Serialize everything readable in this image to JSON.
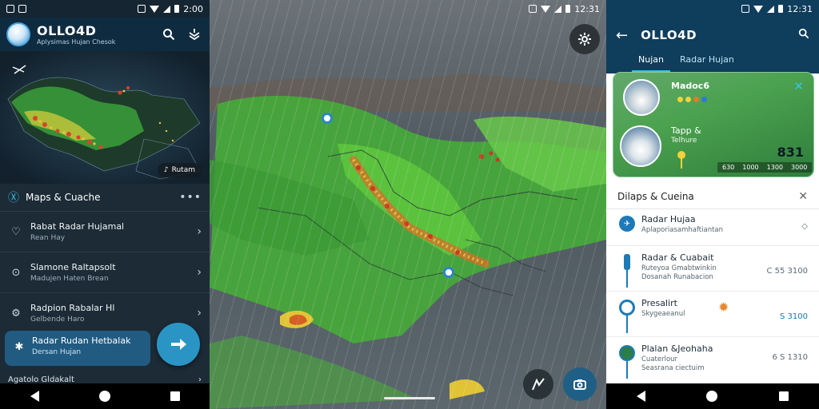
{
  "status": {
    "left_time": "2:00",
    "middle_time": "12:31",
    "right_time": "12:31"
  },
  "left_screen": {
    "app_title": "OLLO4D",
    "app_subtitle": "Aplysimas Hujan Chesok",
    "map_chip": "Rutam",
    "sheet_title": "Maps & Cuache",
    "items": [
      {
        "title": "Rabat Radar Hujamal",
        "subtitle": "Rean Hay"
      },
      {
        "title": "Slamone Raltapsolt",
        "subtitle": "Madujen Haten Brean"
      },
      {
        "title": "Radpion Rabalar Hl",
        "subtitle": "Gelbende Haro"
      },
      {
        "title": "Radar Rudan Hetbalak",
        "subtitle": "Dersan Hujan"
      },
      {
        "title": "Agatolo Gldakalt"
      }
    ]
  },
  "right_screen": {
    "app_title": "OLLO4D",
    "tabs": [
      {
        "label": "Nujan"
      },
      {
        "label": "Radar Hujan"
      }
    ],
    "card": {
      "title1": "Madoc6",
      "title2": "Tapp &",
      "subtitle2": "Telhure",
      "temperature": "831",
      "scale": [
        "630",
        "1000",
        "1300",
        "3000"
      ]
    },
    "list_title": "Dilaps & Cueina",
    "rows": [
      {
        "title": "Radar Hujaa",
        "subtitle": "Aplaporiasamhaftiantan",
        "value": ""
      },
      {
        "title": "Radar & Cuabait",
        "subtitle": "Ruteyoa Gmabtwinkin\nDosanah Runabacion",
        "value": "C 55 3100"
      },
      {
        "title": "Presalirt",
        "subtitle": "Skygeaeanul",
        "value": "S 3100"
      },
      {
        "title": "Plalan &Jeohaha",
        "subtitle": "Cuaterlour\nSeasrana ciectuim",
        "value": "6 S 1310"
      }
    ]
  }
}
